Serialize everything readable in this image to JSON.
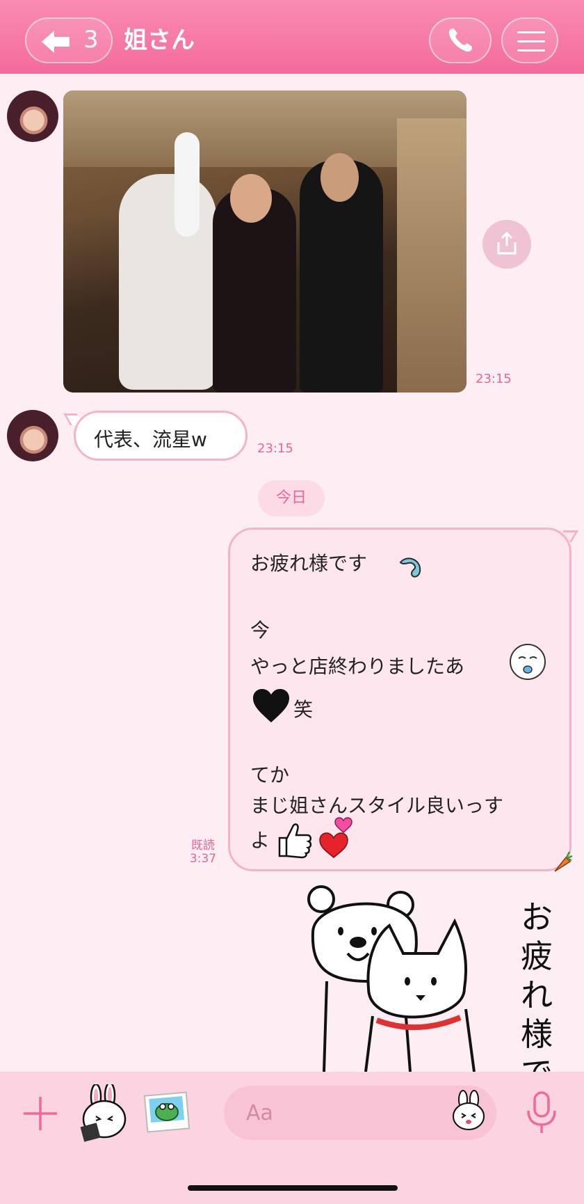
{
  "header": {
    "back_count": "3",
    "title": "姐さん"
  },
  "messages": {
    "photo_time": "23:15",
    "text1": "代表、流星w",
    "text1_time": "23:15",
    "date_label": "今日",
    "my_message_lines": [
      "お疲れ様です",
      "今",
      "やっと店終わりましたあ",
      "笑",
      "てか",
      "まじ姐さんスタイル良いっす",
      "よ"
    ],
    "read_label": "既読",
    "read_time": "3:37"
  },
  "sticker_text": [
    "お",
    "疲",
    "れ",
    "様",
    "で"
  ],
  "input": {
    "placeholder": "Aa"
  },
  "colors": {
    "header": "#f46a9c",
    "background": "#fdeef3",
    "accent": "#e8669a",
    "footer": "#fbd3e1"
  },
  "icons": [
    "back-arrow-icon",
    "phone-icon",
    "hamburger-menu-icon",
    "share-icon",
    "plus-icon",
    "sticker-icon",
    "photo-icon",
    "emoji-icon",
    "mic-icon"
  ]
}
